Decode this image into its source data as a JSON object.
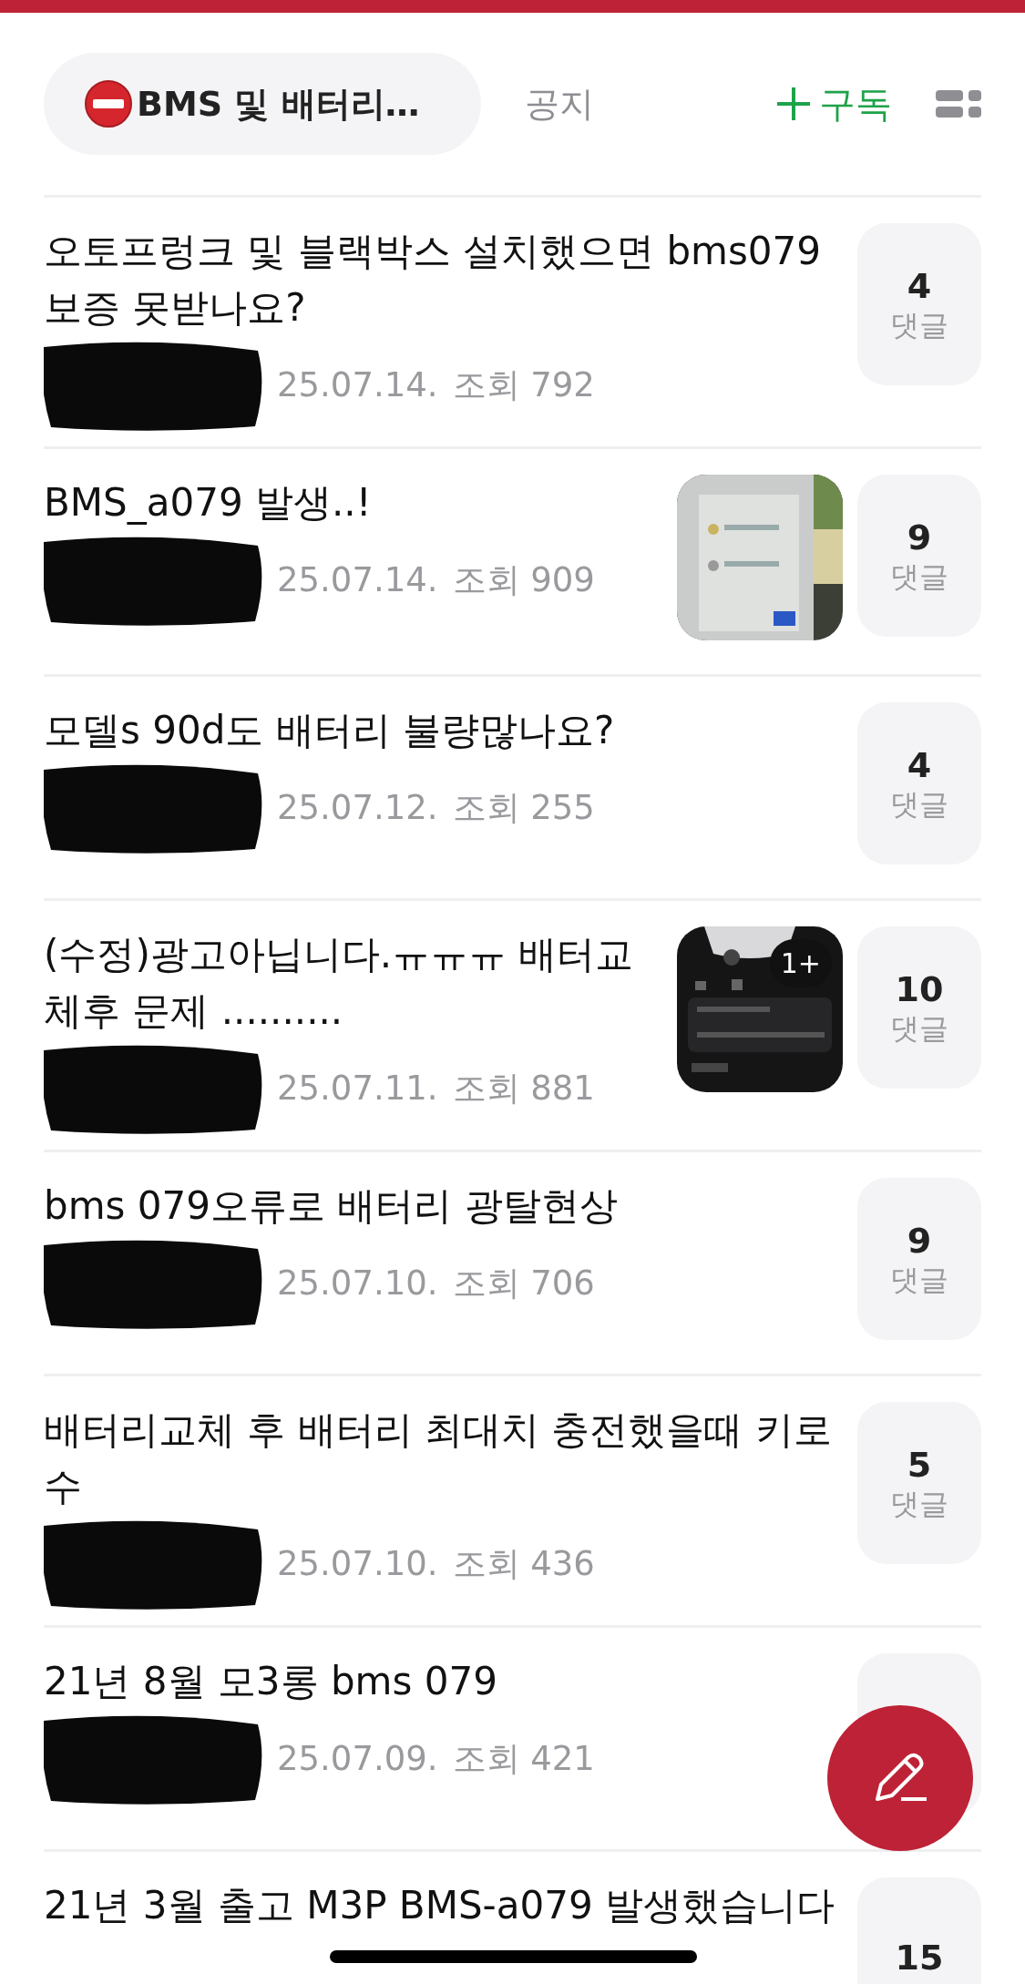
{
  "header": {
    "board": {
      "label": "BMS 및 배터리…",
      "selected": true
    },
    "notice_tab": {
      "label": "공지",
      "selected": false
    },
    "subscribe": {
      "label": "구독"
    }
  },
  "posts": [
    {
      "title": "오토프렁크 및 블랙박스 설치했으면 bms079 보증 못받나요?",
      "date": "25.07.14.",
      "views": "조회 792",
      "comments": "4",
      "comments_label": "댓글"
    },
    {
      "title": "BMS_a079 발생..!",
      "date": "25.07.14.",
      "views": "조회 909",
      "comments": "9",
      "comments_label": "댓글",
      "thumbnail": {
        "kind": "screen"
      }
    },
    {
      "title": "모델s 90d도 배터리 불량많나요?",
      "date": "25.07.12.",
      "views": "조회 255",
      "comments": "4",
      "comments_label": "댓글"
    },
    {
      "title": "(수정)광고아닙니다.ㅠㅠㅠ 배터교체후 문제 ..........",
      "date": "25.07.11.",
      "views": "조회 881",
      "comments": "10",
      "comments_label": "댓글",
      "thumbnail": {
        "kind": "dashboard",
        "more": "1+"
      }
    },
    {
      "title": "bms 079오류로 배터리 광탈현상",
      "date": "25.07.10.",
      "views": "조회 706",
      "comments": "9",
      "comments_label": "댓글"
    },
    {
      "title": "배터리교체 후 배터리 최대치 충전했을때 키로수",
      "date": "25.07.10.",
      "views": "조회 436",
      "comments": "5",
      "comments_label": "댓글"
    },
    {
      "title": "21년 8월 모3롱 bms 079",
      "date": "25.07.09.",
      "views": "조회 421"
    },
    {
      "title": "21년 3월 출고 M3P BMS-a079 발생했습니다",
      "comments": "15"
    }
  ]
}
